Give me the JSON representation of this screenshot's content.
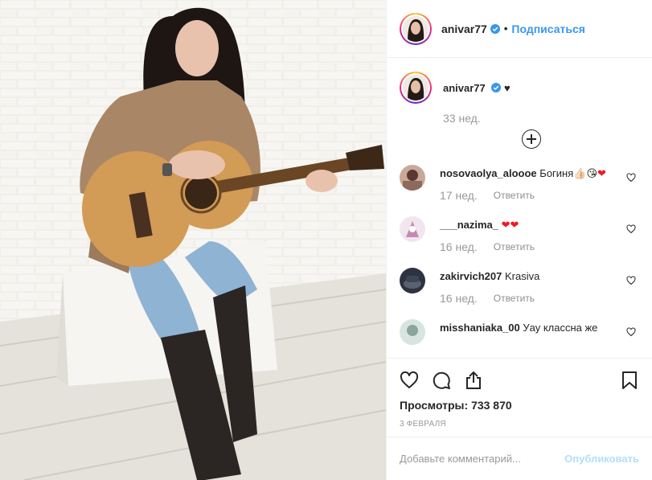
{
  "post": {
    "username": "anivar77",
    "follow_label": "Подписаться",
    "dot": "•"
  },
  "caption": {
    "username": "anivar77",
    "text": "♥",
    "time": "33 нед."
  },
  "comments": [
    {
      "username": "nosovaolya_aloooe",
      "text": "Богиня👍🏻😘",
      "heart": "❤",
      "time": "17 нед.",
      "reply": "Ответить"
    },
    {
      "username": "___nazima_",
      "text": "",
      "heart": "❤❤",
      "time": "16 нед.",
      "reply": "Ответить"
    },
    {
      "username": "zakirvich207",
      "text": "Krasiva",
      "heart": "",
      "time": "16 нед.",
      "reply": "Ответить"
    },
    {
      "username": "misshaniaka_00",
      "text": "Уау классна же",
      "heart": "",
      "time": "",
      "reply": ""
    }
  ],
  "stats": {
    "views_label": "Просмотры:",
    "views_value": "733 870",
    "date": "3 ФЕВРАЛЯ"
  },
  "add_comment": {
    "placeholder": "Добавьте комментарий...",
    "publish_label": "Опубликовать"
  },
  "icons": [
    "heart-icon",
    "comment-icon",
    "share-icon",
    "bookmark-icon",
    "verified-badge-icon",
    "plus-circle-icon"
  ],
  "colors": {
    "link": "#3897f0",
    "muted": "#999999",
    "publish_disabled": "#b2dffc",
    "heart": "#ed1b24"
  }
}
